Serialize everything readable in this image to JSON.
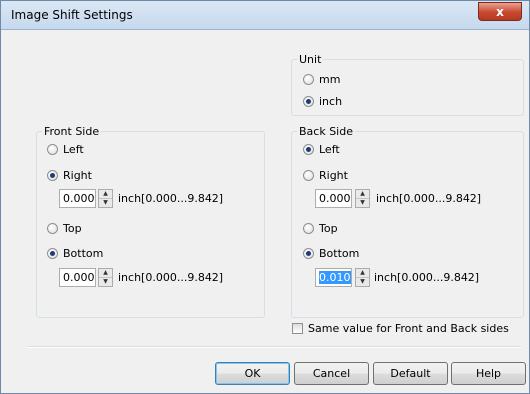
{
  "window": {
    "title": "Image Shift Settings",
    "close_glyph": "x"
  },
  "unit": {
    "label": "Unit",
    "options": [
      {
        "label": "mm",
        "checked": false
      },
      {
        "label": "inch",
        "checked": true
      }
    ]
  },
  "front": {
    "label": "Front Side",
    "left": {
      "label": "Left",
      "checked": false
    },
    "right": {
      "label": "Right",
      "checked": true
    },
    "horizontal": {
      "value": "0.000",
      "range": "inch[0.000...9.842]"
    },
    "top": {
      "label": "Top",
      "checked": false
    },
    "bottom": {
      "label": "Bottom",
      "checked": true
    },
    "vertical": {
      "value": "0.000",
      "range": "inch[0.000...9.842]"
    }
  },
  "back": {
    "label": "Back Side",
    "left": {
      "label": "Left",
      "checked": true
    },
    "right": {
      "label": "Right",
      "checked": false
    },
    "horizontal": {
      "value": "0.000",
      "range": "inch[0.000...9.842]"
    },
    "top": {
      "label": "Top",
      "checked": false
    },
    "bottom": {
      "label": "Bottom",
      "checked": true
    },
    "vertical": {
      "value": "0.010",
      "range": "inch[0.000...9.842]",
      "selected": true
    }
  },
  "same_value": {
    "label": "Same value for Front and Back sides",
    "checked": false
  },
  "buttons": {
    "ok": "OK",
    "cancel": "Cancel",
    "default": "Default",
    "help": "Help"
  },
  "icons": {
    "spin_up": "▲",
    "spin_down": "▼"
  }
}
